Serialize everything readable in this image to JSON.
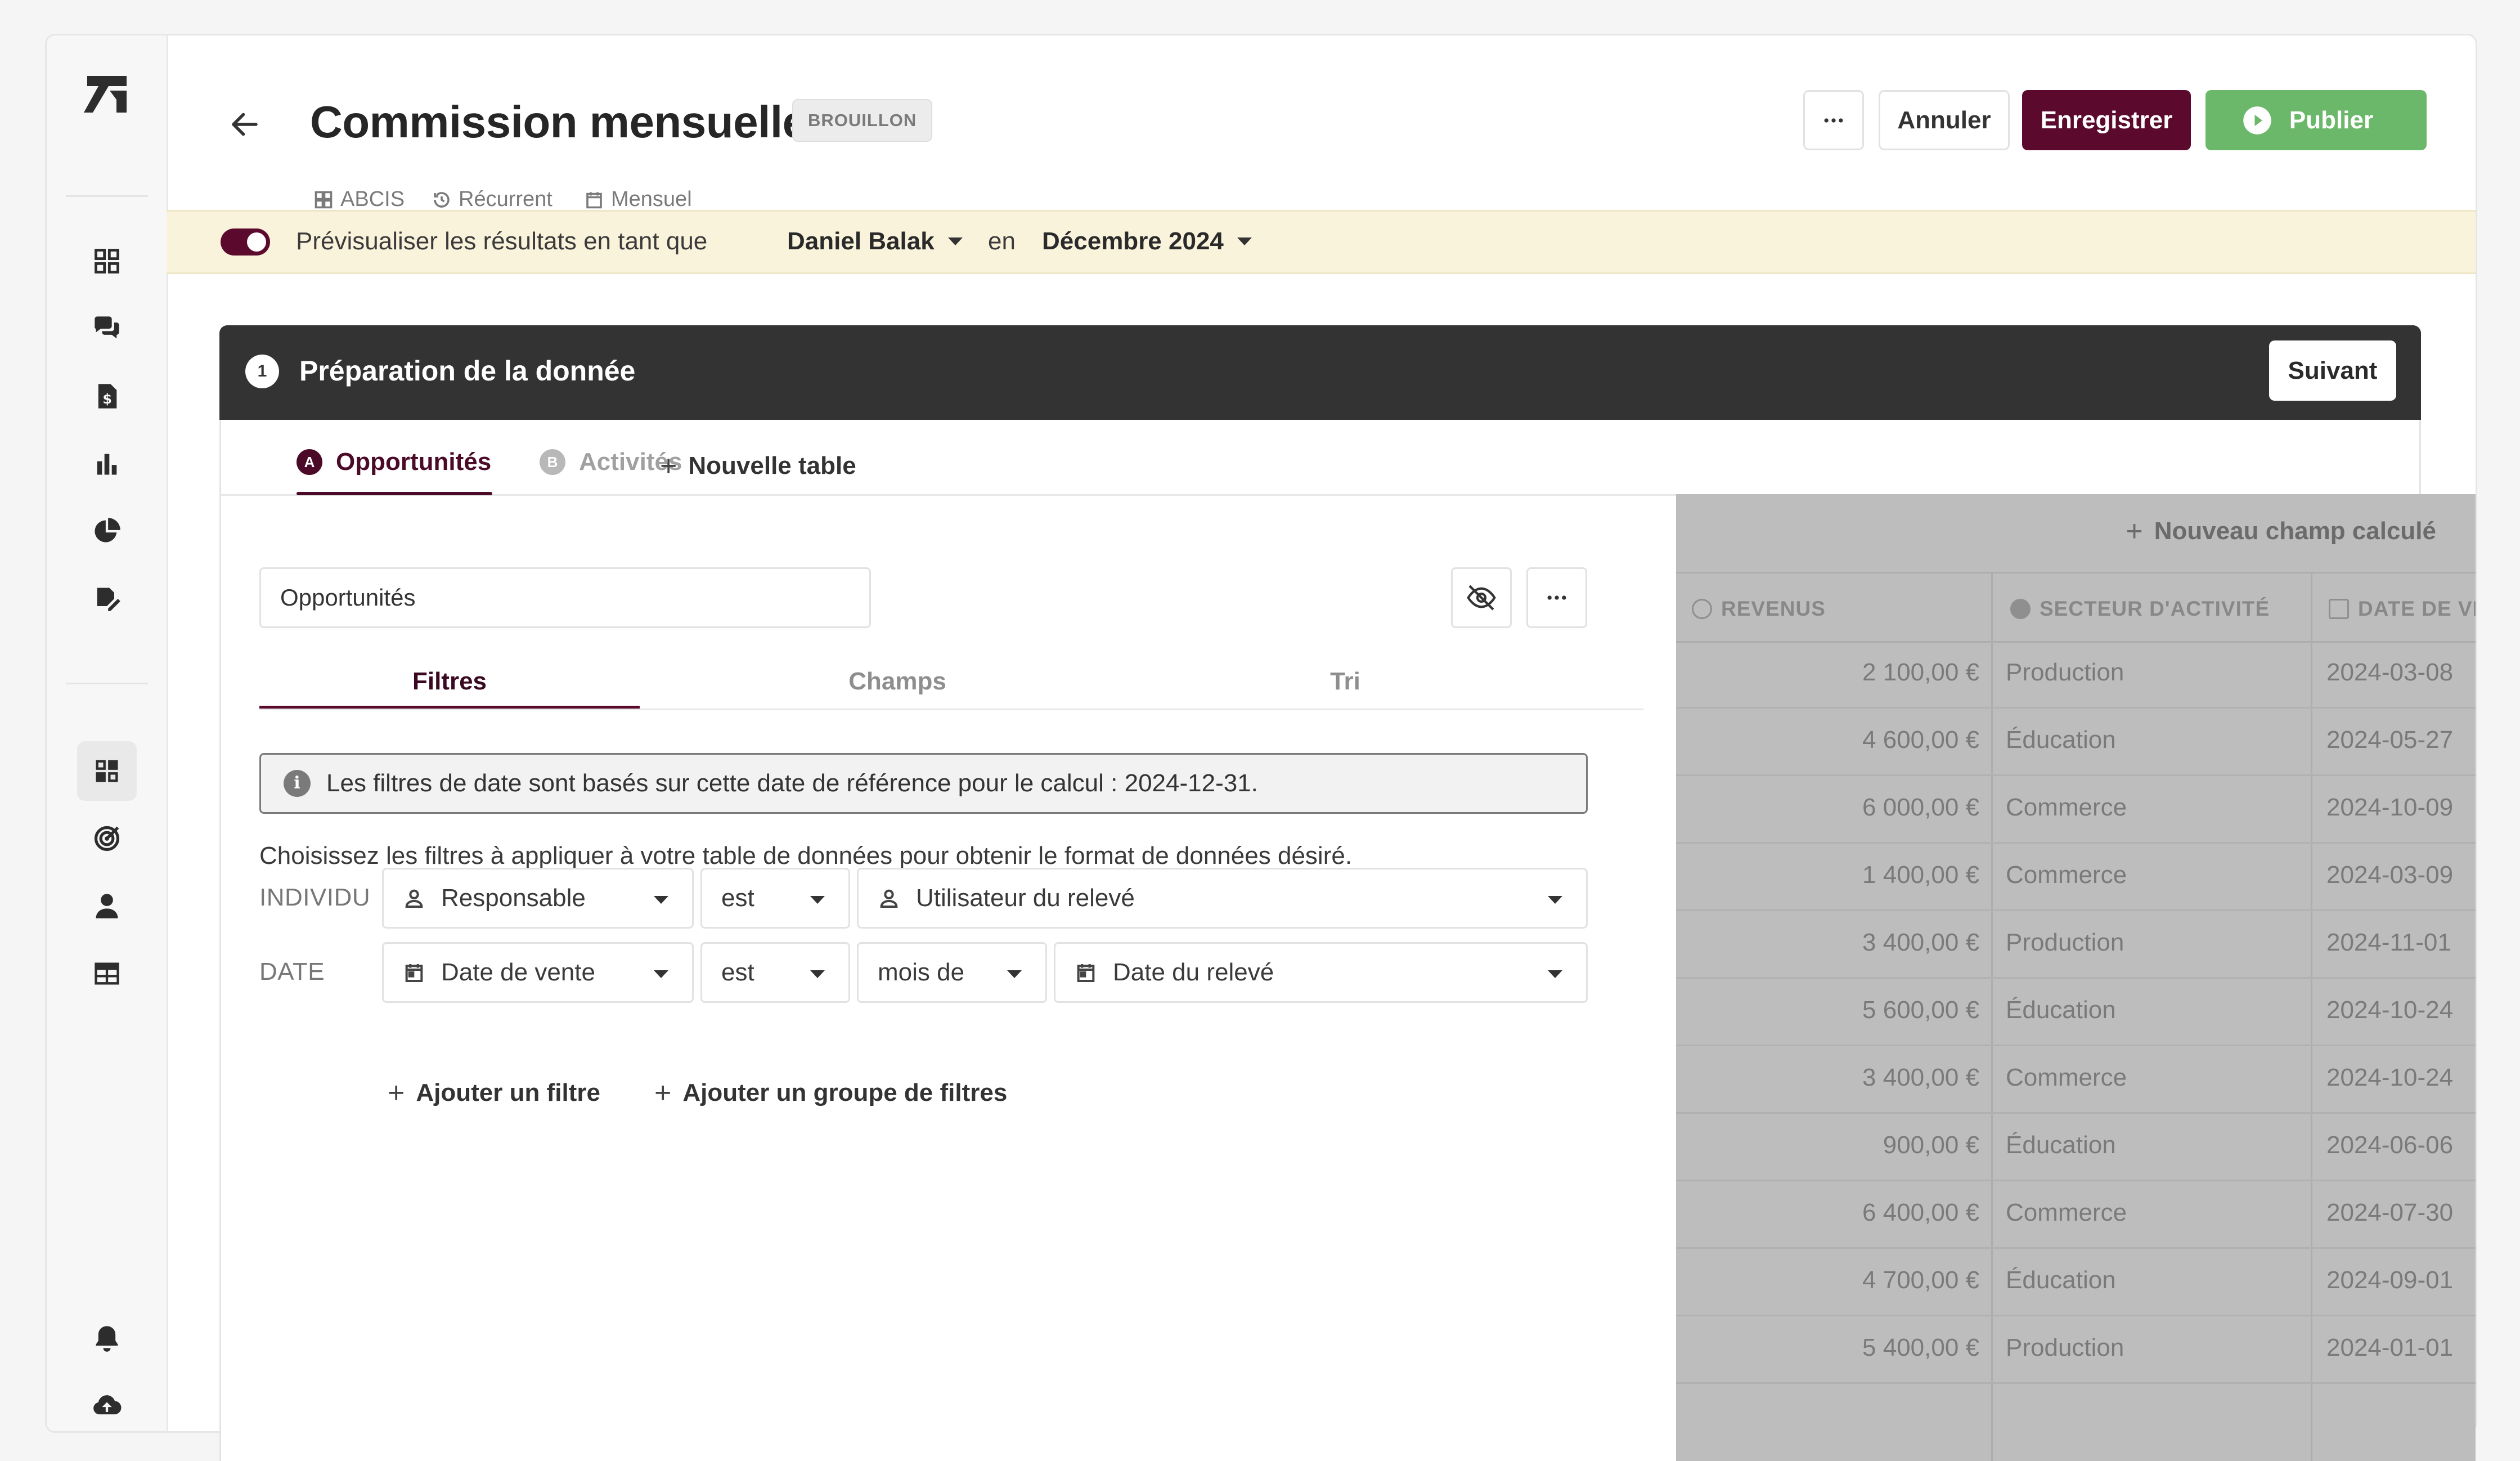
{
  "header": {
    "title": "Commission mensuelle",
    "status_badge": "BROUILLON",
    "meta": {
      "dataset": "ABCIS",
      "recurrence": "Récurrent",
      "period": "Mensuel"
    },
    "buttons": {
      "cancel": "Annuler",
      "save": "Enregistrer",
      "publish": "Publier"
    }
  },
  "preview": {
    "label": "Prévisualiser les résultats en tant que",
    "user": "Daniel Balak",
    "connector": "en",
    "period": "Décembre 2024",
    "enabled": true
  },
  "step": {
    "number": "1",
    "title": "Préparation de la donnée",
    "next_label": "Suivant"
  },
  "tables": {
    "items": [
      {
        "letter": "A",
        "label": "Opportunités",
        "active": true
      },
      {
        "letter": "B",
        "label": "Activités",
        "active": false
      }
    ],
    "new_table_label": "Nouvelle table"
  },
  "table_name": "Opportunités",
  "subtabs": [
    "Filtres",
    "Champs",
    "Tri"
  ],
  "info_text": "Les filtres de date sont basés sur cette date de référence pour le calcul : 2024-12-31.",
  "help_text": "Choisissez les filtres à appliquer à votre table de données pour obtenir le format de données désiré.",
  "filters": [
    {
      "label": "INDIVIDU",
      "field": "Responsable",
      "operator": "est",
      "value": "Utilisateur du relevé"
    },
    {
      "label": "DATE",
      "field": "Date de vente",
      "operator": "est",
      "modifier": "mois de",
      "value": "Date du relevé"
    }
  ],
  "actions": {
    "add_filter": "Ajouter un filtre",
    "add_group": "Ajouter un groupe de filtres"
  },
  "data_panel": {
    "new_calc_field": "Nouveau champ calculé",
    "columns": [
      "REVENUS",
      "SECTEUR D'ACTIVITÉ",
      "DATE DE VE"
    ],
    "rows": [
      [
        "2 100,00 €",
        "Production",
        "2024-03-08"
      ],
      [
        "4 600,00 €",
        "Éducation",
        "2024-05-27"
      ],
      [
        "6 000,00 €",
        "Commerce",
        "2024-10-09"
      ],
      [
        "1 400,00 €",
        "Commerce",
        "2024-03-09"
      ],
      [
        "3 400,00 €",
        "Production",
        "2024-11-01"
      ],
      [
        "5 600,00 €",
        "Éducation",
        "2024-10-24"
      ],
      [
        "3 400,00 €",
        "Commerce",
        "2024-10-24"
      ],
      [
        "900,00 €",
        "Éducation",
        "2024-06-06"
      ],
      [
        "6 400,00 €",
        "Commerce",
        "2024-07-30"
      ],
      [
        "4 700,00 €",
        "Éducation",
        "2024-09-01"
      ],
      [
        "5 400,00 €",
        "Production",
        "2024-01-01"
      ]
    ]
  },
  "colors": {
    "brand": "#5b0a2e",
    "publish": "#6cb86a",
    "banner": "#faf3dc",
    "card_header": "#333333"
  },
  "sidebar_icons": [
    "dashboard-icon",
    "chat-icon",
    "invoice-icon",
    "bar-chart-icon",
    "pie-chart-icon",
    "signature-icon",
    "plan-builder-icon",
    "target-icon",
    "user-icon",
    "table-icon",
    "bell-icon",
    "cloud-upload-icon"
  ]
}
